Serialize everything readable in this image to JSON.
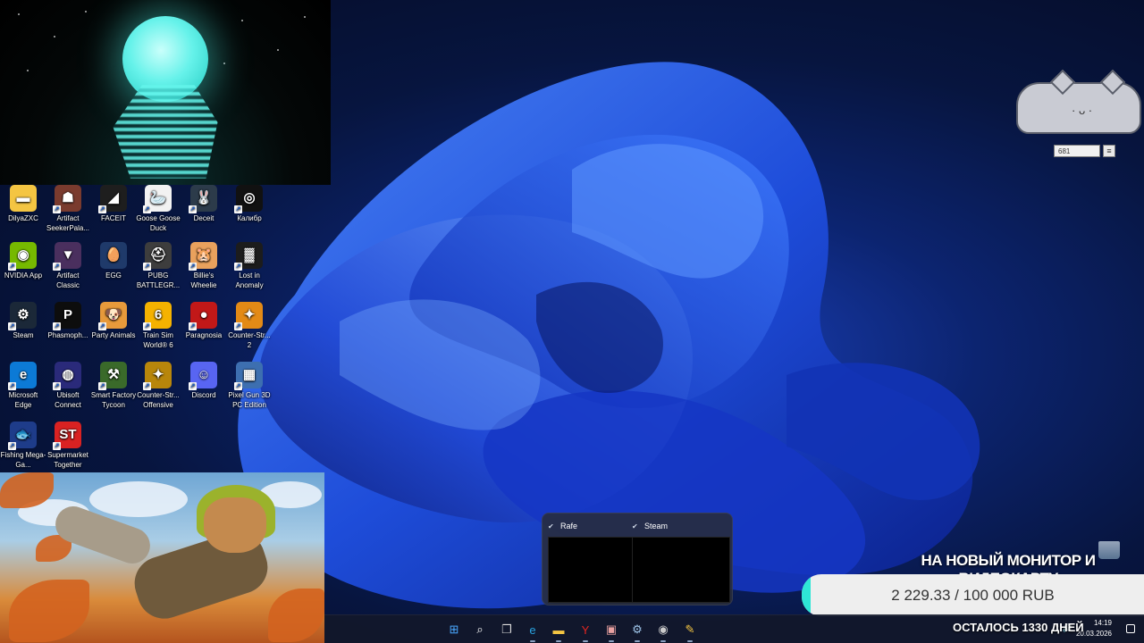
{
  "desktop": {
    "icons": [
      {
        "label": "DilyaZXC",
        "icon": "folder-icon",
        "color": "#f4c542",
        "glyph": "▬",
        "shortcut": false
      },
      {
        "label": "Artifact SeekerPala...",
        "icon": "artifact-seeker-icon",
        "color": "#7a3b2e",
        "glyph": "☗",
        "shortcut": true
      },
      {
        "label": "FACEIT",
        "icon": "faceit-icon",
        "color": "#1e1e1e",
        "glyph": "◢",
        "shortcut": true
      },
      {
        "label": "Goose Goose Duck",
        "icon": "goose-goose-duck-icon",
        "color": "#f2f2f2",
        "glyph": "🦢",
        "shortcut": true
      },
      {
        "label": "Deceit",
        "icon": "deceit-icon",
        "color": "#2c3b4a",
        "glyph": "🐰",
        "shortcut": true
      },
      {
        "label": "Калибр",
        "icon": "kalibr-icon",
        "color": "#111111",
        "glyph": "◎",
        "shortcut": true
      },
      {
        "label": "NVIDIA App",
        "icon": "nvidia-app-icon",
        "color": "#76b900",
        "glyph": "◉",
        "shortcut": true
      },
      {
        "label": "Artifact Classic",
        "icon": "artifact-classic-icon",
        "color": "#4a2f5e",
        "glyph": "▼",
        "shortcut": true
      },
      {
        "label": "EGG",
        "icon": "egg-icon",
        "color": "#1f3a6a",
        "glyph": "🥚",
        "shortcut": false
      },
      {
        "label": "PUBG BATTLEGR...",
        "icon": "pubg-icon",
        "color": "#3d3d3d",
        "glyph": "⛑",
        "shortcut": true
      },
      {
        "label": "Billie's Wheelie",
        "icon": "billies-wheelie-icon",
        "color": "#e9a15d",
        "glyph": "🐹",
        "shortcut": true
      },
      {
        "label": "Lost in Anomaly",
        "icon": "lost-in-anomaly-icon",
        "color": "#1c1c1c",
        "glyph": "▓",
        "shortcut": true
      },
      {
        "label": "Steam",
        "icon": "steam-icon",
        "color": "#1b2838",
        "glyph": "⚙",
        "shortcut": true
      },
      {
        "label": "Phasmoph...",
        "icon": "phasmophobia-icon",
        "color": "#0d0d0d",
        "glyph": "P",
        "shortcut": true
      },
      {
        "label": "Party Animals",
        "icon": "party-animals-icon",
        "color": "#e79a3b",
        "glyph": "🐶",
        "shortcut": true
      },
      {
        "label": "Train Sim World® 6",
        "icon": "train-sim-world-icon",
        "color": "#f5b200",
        "glyph": "6",
        "shortcut": true
      },
      {
        "label": "Paragnosia",
        "icon": "paragnosia-icon",
        "color": "#c21818",
        "glyph": "●",
        "shortcut": true
      },
      {
        "label": "Counter-Str... 2",
        "icon": "counter-strike-2-icon",
        "color": "#e38a16",
        "glyph": "✦",
        "shortcut": true
      },
      {
        "label": "Microsoft Edge",
        "icon": "microsoft-edge-icon",
        "color": "#0c7ad6",
        "glyph": "e",
        "shortcut": true
      },
      {
        "label": "Ubisoft Connect",
        "icon": "ubisoft-connect-icon",
        "color": "#2a2a7a",
        "glyph": "◍",
        "shortcut": true
      },
      {
        "label": "Smart Factory Tycoon",
        "icon": "smart-factory-tycoon-icon",
        "color": "#3a6a2a",
        "glyph": "⚒",
        "shortcut": true
      },
      {
        "label": "Counter-Str... Offensive",
        "icon": "counter-strike-offensive-icon",
        "color": "#b8860b",
        "glyph": "✦",
        "shortcut": true
      },
      {
        "label": "Discord",
        "icon": "discord-icon",
        "color": "#5865f2",
        "glyph": "☺",
        "shortcut": true
      },
      {
        "label": "Pixel Gun 3D PC Edition",
        "icon": "pixel-gun-3d-icon",
        "color": "#3d6fb0",
        "glyph": "▦",
        "shortcut": true
      },
      {
        "label": "Fishing Mega-Ga...",
        "icon": "fishing-mega-game-icon",
        "color": "#1e3c8a",
        "glyph": "🐟",
        "shortcut": true
      },
      {
        "label": "Supermarket Together",
        "icon": "supermarket-together-icon",
        "color": "#d92222",
        "glyph": "ST",
        "shortcut": true
      }
    ]
  },
  "cat_widget": {
    "count": "681",
    "menu_icon": "hamburger-icon"
  },
  "thumbnail_preview": [
    {
      "title": "Rafe",
      "icon": "rafe-app-icon"
    },
    {
      "title": "Steam",
      "icon": "steam-icon"
    }
  ],
  "donation": {
    "title": "НА НОВЫЙ МОНИТОР И ВИДЕОКАРТУ",
    "amount_text": "2 229.33 / 100 000 RUB",
    "progress": 0.0223,
    "bar_color": "#2ee6d6",
    "days_left": "ОСТАЛОСЬ 1330 ДНЕЙ"
  },
  "taskbar": {
    "buttons": [
      {
        "name": "start-button",
        "glyph": "⊞",
        "color": "#4aa8ff"
      },
      {
        "name": "search-button",
        "glyph": "⌕",
        "color": "#ffffff"
      },
      {
        "name": "task-view-button",
        "glyph": "❐",
        "color": "#dddddd"
      },
      {
        "name": "edge-taskbar-button",
        "glyph": "e",
        "color": "#29a3e0"
      },
      {
        "name": "file-explorer-button",
        "glyph": "▬",
        "color": "#f4c542"
      },
      {
        "name": "yandex-browser-button",
        "glyph": "Y",
        "color": "#e52620"
      },
      {
        "name": "photos-button",
        "glyph": "▣",
        "color": "#e8a0a0"
      },
      {
        "name": "steam-taskbar-button",
        "glyph": "⚙",
        "color": "#9ec4e8"
      },
      {
        "name": "obs-taskbar-button",
        "glyph": "◉",
        "color": "#cccccc"
      },
      {
        "name": "app-taskbar-button",
        "glyph": "✎",
        "color": "#f4c542"
      }
    ],
    "clock_time": "14:19",
    "clock_date": "20.03.2026"
  }
}
